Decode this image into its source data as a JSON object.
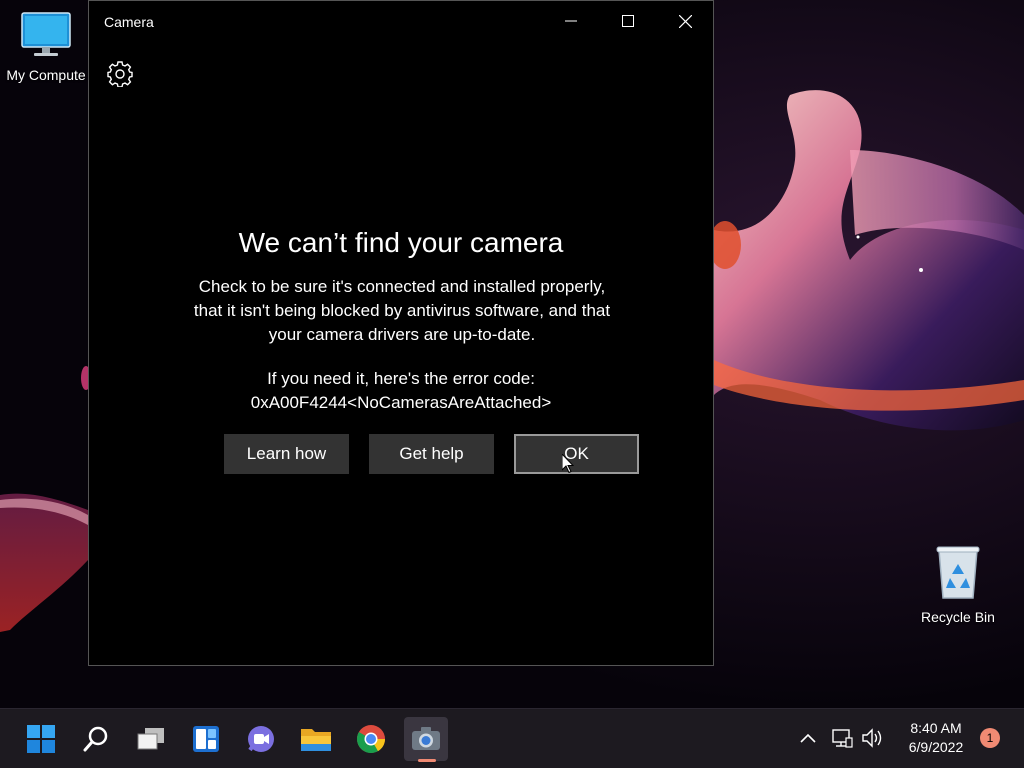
{
  "desktop": {
    "icons": [
      {
        "label": "My Compute",
        "icon": "monitor-icon"
      },
      {
        "label": "Recycle Bin",
        "icon": "recycle-bin-icon"
      }
    ]
  },
  "window": {
    "title": "Camera",
    "controls": {
      "minimize": "minimize-icon",
      "maximize": "maximize-icon",
      "close": "close-icon"
    },
    "settings_icon": "gear-icon"
  },
  "error": {
    "title": "We can’t find your camera",
    "body": "Check to be sure it's connected and installed properly, that it isn't being blocked by antivirus software, and that your camera drivers are up-to-date.",
    "code_label": "If you need it, here's the error code:",
    "code": "0xA00F4244<NoCamerasAreAttached>"
  },
  "buttons": {
    "learn_how": "Learn how",
    "get_help": "Get help",
    "ok": "OK"
  },
  "taskbar": {
    "apps": [
      "start-icon",
      "search-icon",
      "task-view-icon",
      "widgets-icon",
      "teams-chat-icon",
      "file-explorer-icon",
      "chrome-icon",
      "camera-icon"
    ],
    "active_app": "camera-icon",
    "tray": [
      "chevron-up-icon",
      "network-icon",
      "volume-icon"
    ],
    "time": "8:40 AM",
    "date": "6/9/2022",
    "notifications": "1"
  },
  "colors": {
    "accent": "#f08a73",
    "taskbar_bg": "#1d1a20",
    "window_bg": "#000000",
    "button_bg": "#333333"
  }
}
